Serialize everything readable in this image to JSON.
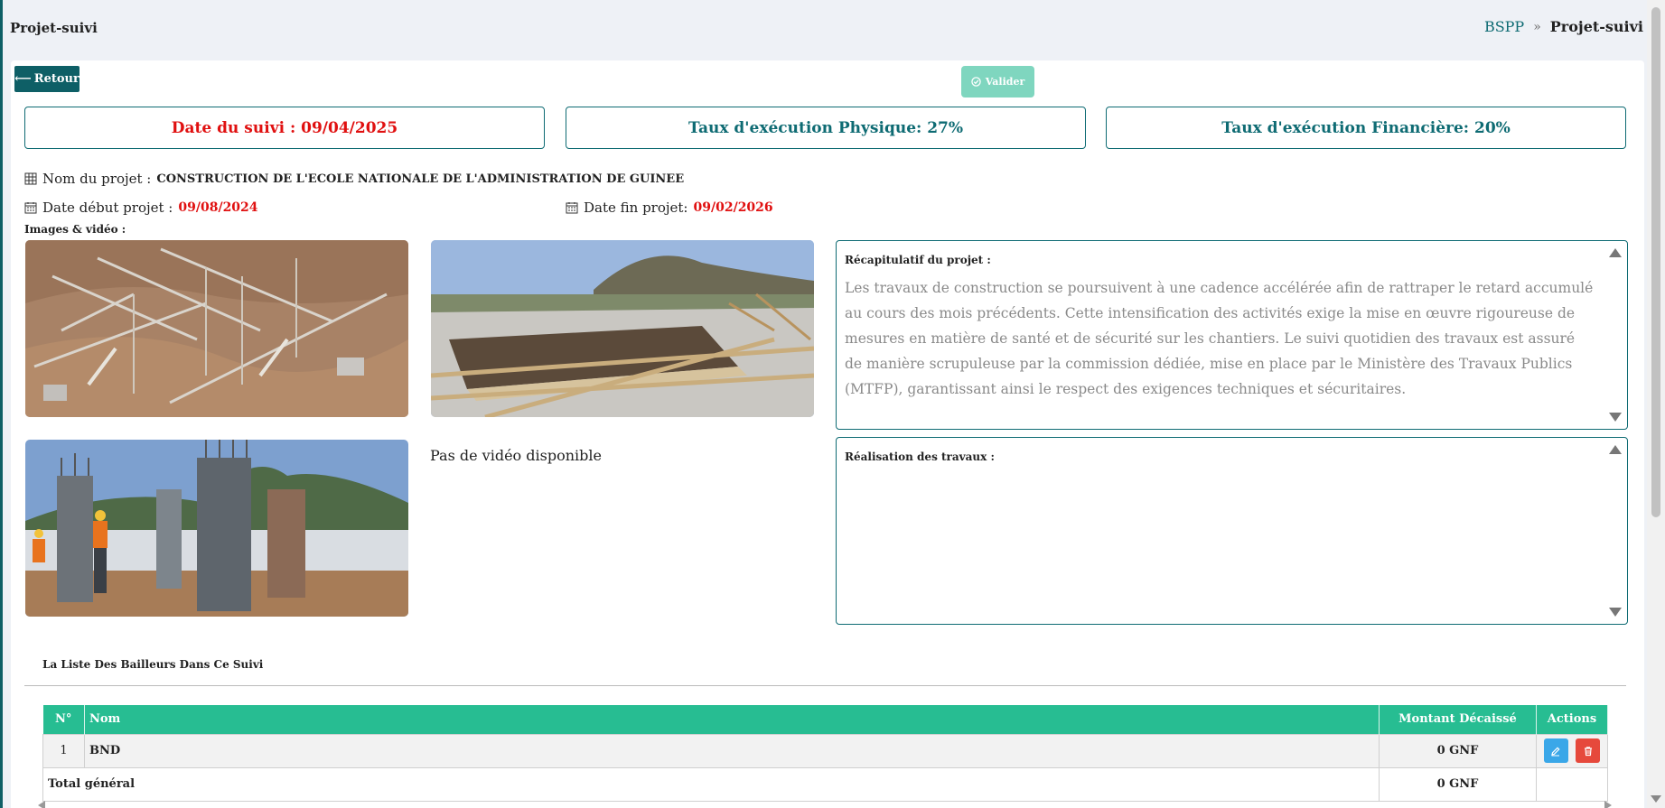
{
  "header": {
    "page_title": "Projet-suivi",
    "breadcrumb": {
      "link": "BSPP",
      "separator": "»",
      "current": "Projet-suivi"
    }
  },
  "actions": {
    "back_label": "Retour",
    "validate_label": "Valider"
  },
  "summary_boxes": {
    "date_suivi": "Date du suivi : 09/04/2025",
    "taux_physique": "Taux d'exécution Physique: 27%",
    "taux_financier": "Taux d'exécution Financière: 20%"
  },
  "execution_rates": {
    "physique_percent": 27,
    "financiere_percent": 20
  },
  "project": {
    "name_label": "Nom du projet :",
    "name_value": "CONSTRUCTION DE L'ECOLE NATIONALE DE L'ADMINISTRATION DE GUINEE",
    "start_label": "Date début projet :",
    "start_value": "09/08/2024",
    "end_label": "Date fin projet:",
    "end_value": "09/02/2026"
  },
  "media": {
    "label": "Images & vidéo :",
    "no_video_text": "Pas de vidéo disponible",
    "photos": [
      "construction-site-foundations",
      "concrete-slab-formwork-mountain",
      "steel-column-formwork-workers"
    ]
  },
  "recap": {
    "title": "Récapitulatif du projet :",
    "body": "Les travaux de construction se poursuivent à une cadence accélérée afin de rattraper le retard accumulé au cours des mois précédents. Cette intensification des activités exige la mise en œuvre rigoureuse de mesures en matière de santé et de sécurité sur les chantiers. Le suivi quotidien des travaux est assuré de manière scrupuleuse par la commission dédiée, mise en place par le Ministère des Travaux Publics (MTFP), garantissant ainsi le respect des exigences techniques et sécuritaires."
  },
  "realisation": {
    "title": "Réalisation des travaux :",
    "body": ""
  },
  "bailleurs": {
    "section_title": "La Liste Des Bailleurs Dans Ce Suivi",
    "columns": {
      "num": "N°",
      "nom": "Nom",
      "montant": "Montant Décaissé",
      "actions": "Actions"
    },
    "rows": [
      {
        "num": "1",
        "nom": "BND",
        "montant": "0 GNF"
      }
    ],
    "total_label": "Total général",
    "total_value": "0 GNF"
  },
  "colors": {
    "primary": "#0e5f66",
    "accent_green": "#27bd92",
    "valider_bg": "#7fd6bf",
    "danger_red": "#e01010",
    "edit_blue": "#3aa7e8",
    "delete_red": "#e6493c"
  }
}
